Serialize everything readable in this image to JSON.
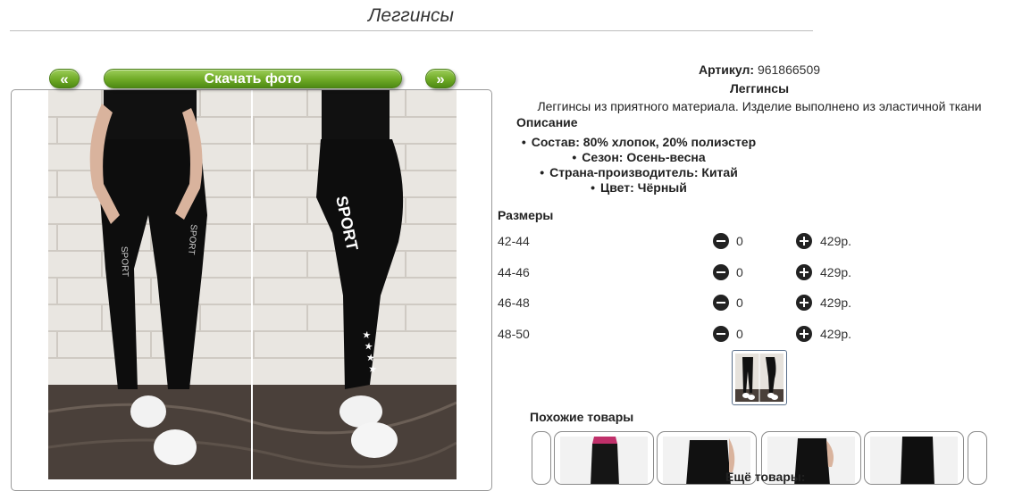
{
  "page": {
    "title": "Леггинсы"
  },
  "gallery": {
    "prev_label": "«",
    "download_label": "Скачать фото",
    "next_label": "»",
    "photo_print_text": "SPORT"
  },
  "product": {
    "sku_label": "Артикул:",
    "sku_value": "961866509",
    "name": "Леггинсы",
    "description": "Леггинсы из приятного материала. Изделие выполнено из эластичной ткани",
    "description_heading": "Описание",
    "properties": [
      "Состав: 80% хлопок, 20% полиэстер",
      "Сезон: Осень-весна",
      "Страна-производитель: Китай",
      "Цвет: Чёрный"
    ],
    "bullet": "•"
  },
  "sizes": {
    "heading": "Размеры",
    "rows": [
      {
        "size": "42-44",
        "qty": "0",
        "price": "429р."
      },
      {
        "size": "44-46",
        "qty": "0",
        "price": "429р."
      },
      {
        "size": "46-48",
        "qty": "0",
        "price": "429р."
      },
      {
        "size": "48-50",
        "qty": "0",
        "price": "429р."
      }
    ]
  },
  "similar": {
    "heading": "Похожие товары",
    "more_label": "Ещё товары:"
  },
  "colors": {
    "accent_green": "#6faa26",
    "text": "#222222",
    "leggings": "#0d0d0d",
    "brick": "#e9e6e1"
  },
  "icons": [
    "minus-circle-icon",
    "plus-circle-icon"
  ]
}
